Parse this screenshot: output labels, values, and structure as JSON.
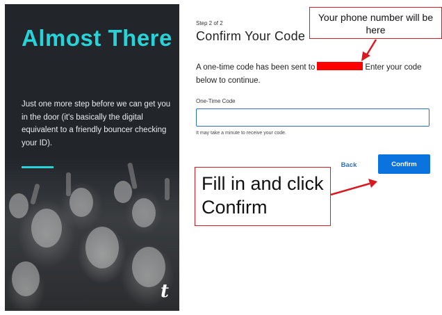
{
  "hero": {
    "title": "Almost There",
    "text": "Just one more step before we can get you in the door (it's basically the digital equivalent to a friendly bouncer checking your ID).",
    "brand_mark": "t"
  },
  "form": {
    "step": "Step 2 of 2",
    "title": "Confirm Your Code",
    "message_before": "A one-time code has been sent to",
    "message_after": "Enter your code below to continue.",
    "field_label": "One-Time Code",
    "field_value": "",
    "field_placeholder": "",
    "hint": "It may take a minute to receive your code.",
    "back_label": "Back",
    "confirm_label": "Confirm"
  },
  "annotations": {
    "phone_note": "Your phone number will be here",
    "confirm_note": "Fill in and click Confirm"
  },
  "colors": {
    "accent": "#27d3d8",
    "primary": "#0b73dd",
    "annotation": "#d9181f",
    "redaction": "#ff0000",
    "panel_dark": "#22262b"
  }
}
